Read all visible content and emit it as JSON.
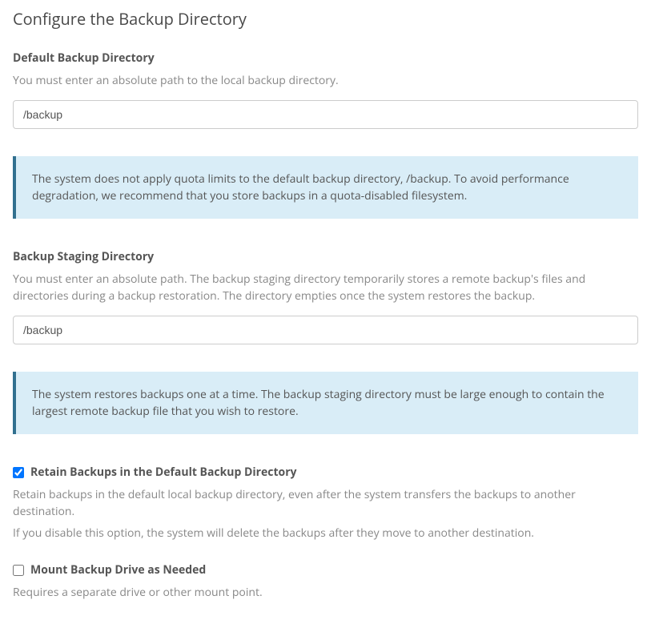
{
  "page": {
    "title": "Configure the Backup Directory"
  },
  "default_backup": {
    "label": "Default Backup Directory",
    "help": "You must enter an absolute path to the local backup directory.",
    "value": "/backup",
    "alert": "The system does not apply quota limits to the default backup directory, /backup. To avoid performance degradation, we recommend that you store backups in a quota-disabled filesystem."
  },
  "staging": {
    "label": "Backup Staging Directory",
    "help": "You must enter an absolute path. The backup staging directory temporarily stores a remote backup's files and directories during a backup restoration. The directory empties once the system restores the backup.",
    "value": "/backup",
    "alert": "The system restores backups one at a time. The backup staging directory must be large enough to contain the largest remote backup file that you wish to restore."
  },
  "retain": {
    "label": "Retain Backups in the Default Backup Directory",
    "help1": "Retain backups in the default local backup directory, even after the system transfers the backups to another destination.",
    "help2": "If you disable this option, the system will delete the backups after they move to another destination."
  },
  "mount": {
    "label": "Mount Backup Drive as Needed",
    "help": "Requires a separate drive or other mount point."
  }
}
